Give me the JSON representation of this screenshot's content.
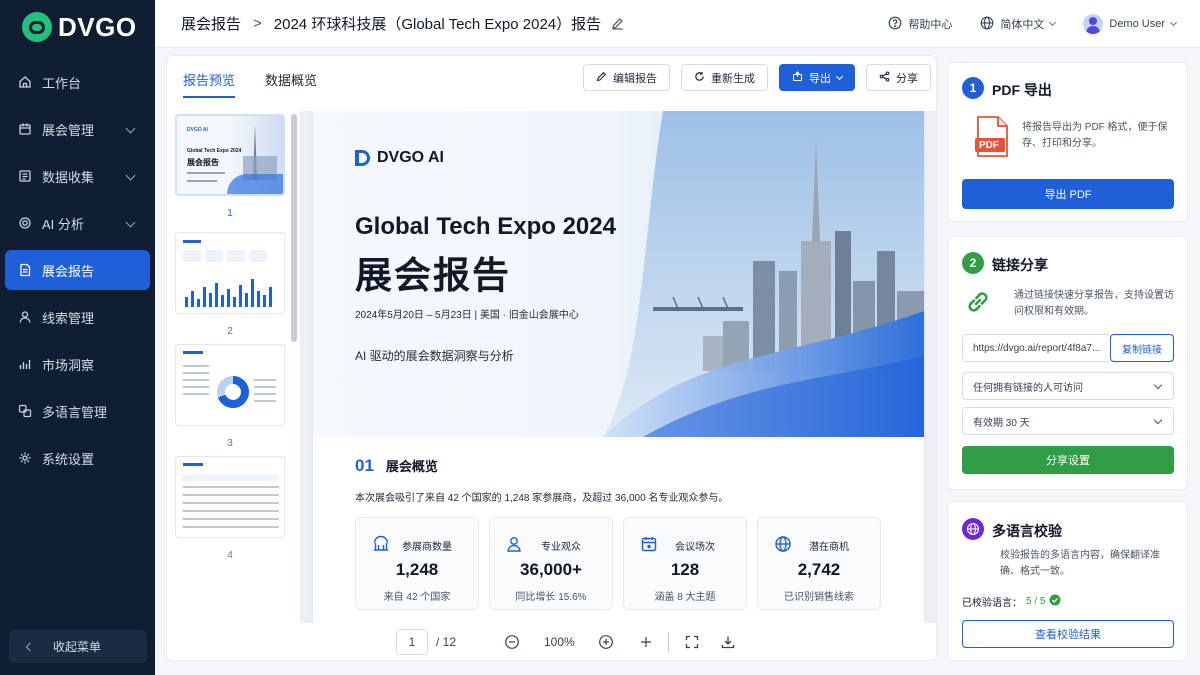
{
  "brand": {
    "name": "DVGO"
  },
  "sidebar": {
    "items": [
      {
        "label": "工作台",
        "icon": "home-icon",
        "expandable": false,
        "active": false
      },
      {
        "label": "展会管理",
        "icon": "calendar-icon",
        "expandable": true,
        "active": false
      },
      {
        "label": "数据收集",
        "icon": "form-icon",
        "expandable": true,
        "active": false
      },
      {
        "label": "AI 分析",
        "icon": "ai-gear-icon",
        "expandable": true,
        "active": false
      },
      {
        "label": "展会报告",
        "icon": "report-icon",
        "expandable": false,
        "active": true
      },
      {
        "label": "线索管理",
        "icon": "user-icon",
        "expandable": false,
        "active": false
      },
      {
        "label": "市场洞察",
        "icon": "bar-chart-icon",
        "expandable": false,
        "active": false
      },
      {
        "label": "多语言管理",
        "icon": "translate-icon",
        "expandable": false,
        "active": false
      },
      {
        "label": "系统设置",
        "icon": "gear-icon",
        "expandable": false,
        "active": false
      }
    ],
    "collapse_label": "收起菜单"
  },
  "header": {
    "breadcrumb_root": "展会报告",
    "breadcrumb_sep": ">",
    "breadcrumb_current": "2024 环球科技展（Global Tech Expo 2024）报告",
    "help": "帮助中心",
    "language": "简体中文",
    "user": "Demo User"
  },
  "tabs": [
    {
      "label": "报告预览",
      "active": true
    },
    {
      "label": "数据概览",
      "active": false
    }
  ],
  "toolbar": {
    "edit": "编辑报告",
    "regenerate": "重新生成",
    "export": "导出",
    "share": "分享"
  },
  "thumbnails": [
    {
      "page": "1",
      "selected": true,
      "logo": "DVGO AI",
      "title": "Global Tech Expo 2024",
      "subtitle": "展会报告"
    },
    {
      "page": "2",
      "selected": false,
      "logo": "",
      "title": "",
      "subtitle": ""
    },
    {
      "page": "3",
      "selected": false,
      "logo": "",
      "title": "",
      "subtitle": ""
    },
    {
      "page": "4",
      "selected": false,
      "logo": "",
      "title": "",
      "subtitle": ""
    }
  ],
  "document": {
    "logo": "DVGO AI",
    "title": "Global Tech Expo 2024",
    "title_cn": "展会报告",
    "date_place": "2024年5月20日 – 5月23日 | 美国 · 旧金山会展中心",
    "subtitle": "AI 驱动的展会数据洞察与分析",
    "section_num": "01",
    "section_title": "展会概览",
    "section_desc": "本次展会吸引了来自 42 个国家的 1,248 家参展商，及超过 36,000 名专业观众参与。",
    "stats": [
      {
        "label": "参展商数量",
        "value": "1,248",
        "note": "来自 42 个国家",
        "icon": "booth-icon"
      },
      {
        "label": "专业观众",
        "value": "36,000+",
        "note": "同比增长 15.6%",
        "icon": "users-icon"
      },
      {
        "label": "会议场次",
        "value": "128",
        "note": "涵盖 8 大主题",
        "icon": "calendar-icon"
      },
      {
        "label": "潜在商机",
        "value": "2,742",
        "note": "已识别销售线索",
        "icon": "globe-icon"
      }
    ]
  },
  "pager": {
    "current": "1",
    "total": "/ 12",
    "zoom": "100%"
  },
  "panel": {
    "pdf": {
      "step": "1",
      "title": "PDF 导出",
      "desc": "将报告导出为 PDF 格式，便于保存、打印和分享。",
      "file_badge": "PDF",
      "button": "导出 PDF"
    },
    "share": {
      "step": "2",
      "title": "链接分享",
      "desc": "通过链接快速分享报告，支持设置访问权限和有效期。",
      "link": "https://dvgo.ai/report/4f8a7...",
      "copy": "复制链接",
      "access": "任何拥有链接的人可访问",
      "expiry": "有效期 30 天",
      "button": "分享设置"
    },
    "multilang": {
      "title": "多语言校验",
      "desc": "校验报告的多语言内容，确保翻译准确、格式一致。",
      "verified_label": "已校验语言：",
      "verified_value": "5 / 5",
      "button": "查看校验结果"
    }
  },
  "colors": {
    "sidebar_bg": "#0f1e33",
    "accent_blue": "#1f5fd8",
    "success_green": "#2f9e44",
    "brand_green": "#22c17d",
    "pdf_red": "#e5533d",
    "purple": "#6d28d9"
  }
}
